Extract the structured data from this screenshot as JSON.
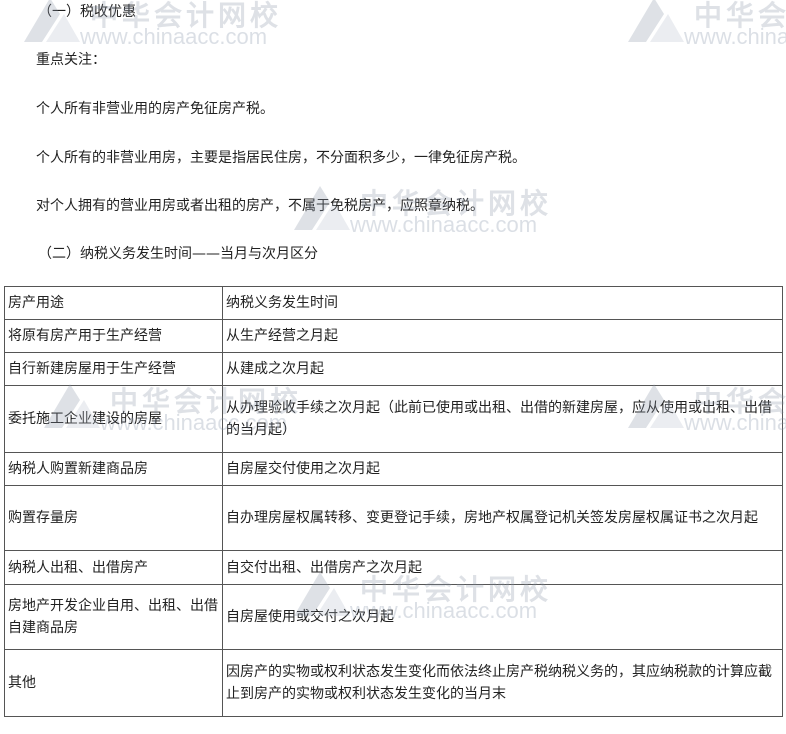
{
  "section1": {
    "title": "（一）税收优惠",
    "focus_label": "重点关注：",
    "rule": "个人所有非营业用的房产免征房产税。",
    "detail": "个人所有的非营业用房，主要是指居民住房，不分面积多少，一律免征房产税。",
    "note": "对个人拥有的营业用房或者出租的房产，不属于免税房产，应照章纳税。"
  },
  "section2": {
    "title": "（二）纳税义务发生时间——当月与次月区分"
  },
  "table": {
    "headers": [
      "房产用途",
      "纳税义务发生时间"
    ],
    "rows": [
      {
        "use": "将原有房产用于生产经营",
        "time": "从生产经营之月起"
      },
      {
        "use": "自行新建房屋用于生产经营",
        "time": "从建成之次月起"
      },
      {
        "use": "委托施工企业建设的房屋",
        "time": "从办理验收手续之次月起（此前已使用或出租、出借的新建房屋，应从使用或出租、出借的当月起）"
      },
      {
        "use": "纳税人购置新建商品房",
        "time": "自房屋交付使用之次月起"
      },
      {
        "use": "购置存量房",
        "time": "自办理房屋权属转移、变更登记手续，房地产权属登记机关签发房屋权属证书之次月起"
      },
      {
        "use": "纳税人出租、出借房产",
        "time": "自交付出租、出借房产之次月起"
      },
      {
        "use": "房地产开发企业自用、出租、出借自建商品房",
        "time": "自房屋使用或交付之次月起"
      },
      {
        "use": "其他",
        "time": "因房产的实物或权利状态发生变化而依法终止房产税纳税义务的，其应纳税款的计算应截止到房产的实物或权利状态发生变化的当月末"
      }
    ]
  },
  "watermark": {
    "text_cn": "中华会计网校",
    "text_url": "www.chinaacc.com",
    "color": "#8a96a8"
  }
}
